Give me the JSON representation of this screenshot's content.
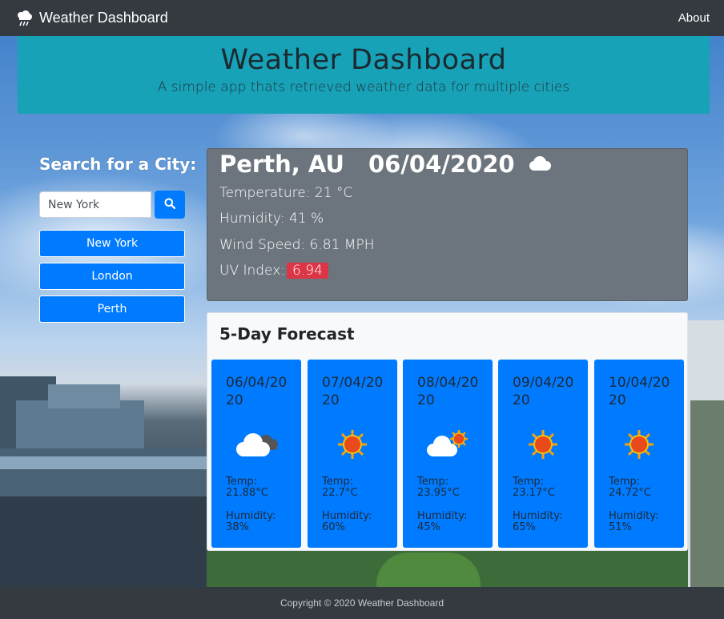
{
  "navbar": {
    "brand": "Weather Dashboard",
    "brand_icon": "cloud-rain-icon",
    "about_link": "About"
  },
  "jumbotron": {
    "title": "Weather Dashboard",
    "subtitle": "A simple app thats retrieved weather data for multiple cities"
  },
  "search": {
    "heading": "Search for a City:",
    "input_value": "New York",
    "button_icon": "search-icon",
    "history": [
      "New York",
      "London",
      "Perth"
    ]
  },
  "current": {
    "city": "Perth, AU",
    "date": "06/04/2020",
    "icon": "cloud-icon",
    "temperature": "Temperature: 21 °C",
    "humidity": "Humidity: 41 %",
    "wind": "Wind Speed: 6.81 MPH",
    "uv_label": "UV Index:",
    "uv_value": "6.94"
  },
  "forecast": {
    "title": "5-Day Forecast",
    "days": [
      {
        "date": "06/04/2020",
        "icon": "cloudy-icon",
        "temp_label": "Temp:",
        "temp": "21.88°C",
        "humidity_label": "Humidity:",
        "humidity": "38%"
      },
      {
        "date": "07/04/2020",
        "icon": "sun-icon",
        "temp_label": "Temp:",
        "temp": "22.7°C",
        "humidity_label": "Humidity:",
        "humidity": "60%"
      },
      {
        "date": "08/04/2020",
        "icon": "partly-cloudy-icon",
        "temp_label": "Temp:",
        "temp": "23.95°C",
        "humidity_label": "Humidity:",
        "humidity": "45%"
      },
      {
        "date": "09/04/2020",
        "icon": "sun-icon",
        "temp_label": "Temp:",
        "temp": "23.17°C",
        "humidity_label": "Humidity:",
        "humidity": "65%"
      },
      {
        "date": "10/04/2020",
        "icon": "sun-icon",
        "temp_label": "Temp:",
        "temp": "24.72°C",
        "humidity_label": "Humidity:",
        "humidity": "51%"
      }
    ]
  },
  "footer": {
    "copyright": "Copyright © 2020 Weather Dashboard"
  },
  "colors": {
    "navbar": "#343a40",
    "jumbotron": "#17a2b8",
    "primary": "#007bff",
    "current_card": "#6c757d",
    "uv_badge": "#dc3545"
  }
}
